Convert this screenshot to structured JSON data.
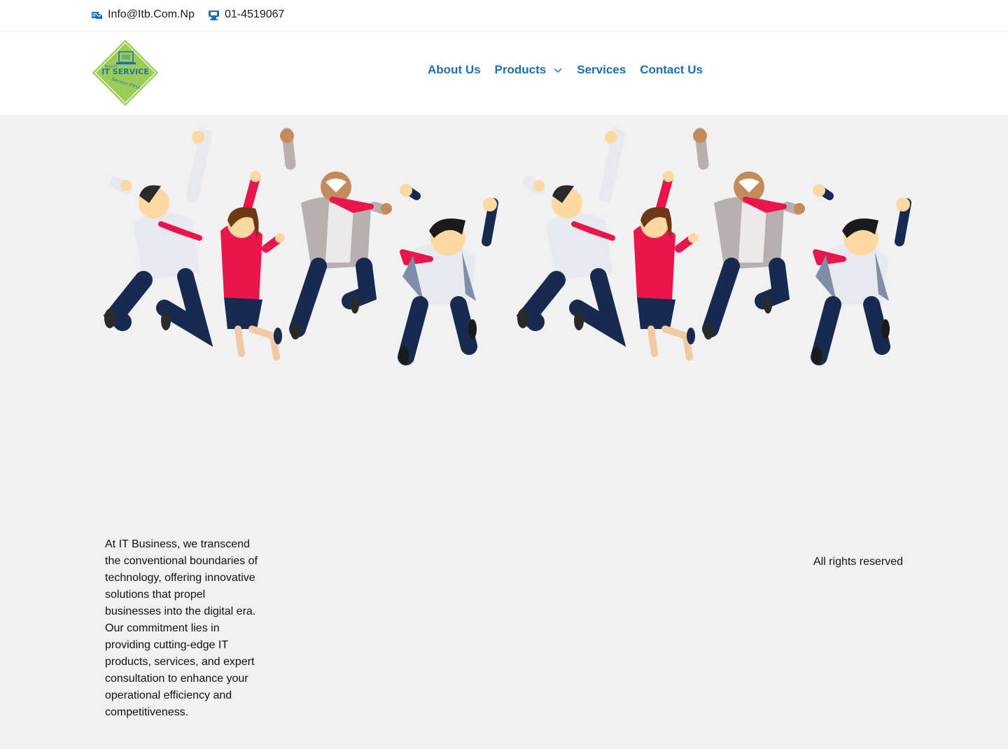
{
  "topbar": {
    "email": "Info@Itb.Com.Np",
    "phone": "01-4519067"
  },
  "logo": {
    "line1": "Beyond",
    "line2": "IT SERVICE",
    "tagline": "Service First"
  },
  "nav": {
    "items": [
      {
        "label": "About Us"
      },
      {
        "label": "Products",
        "has_dropdown": true
      },
      {
        "label": "Services"
      },
      {
        "label": "Contact Us"
      }
    ]
  },
  "footer": {
    "about_text": "At IT Business, we transcend the conventional boundaries of technology, offering innovative solutions that propel businesses into the digital era. Our commitment lies in providing cutting-edge IT products, services, and expert consultation to enhance your operational efficiency and competitiveness.",
    "rights_text": "All rights reserved"
  },
  "colors": {
    "accent": "#1a6fb0",
    "logo_green": "#9ccc58",
    "logo_blue": "#1f6fb3",
    "background": "#f1f1f1",
    "tie_red": "#e8164c",
    "navy": "#172a4f"
  }
}
